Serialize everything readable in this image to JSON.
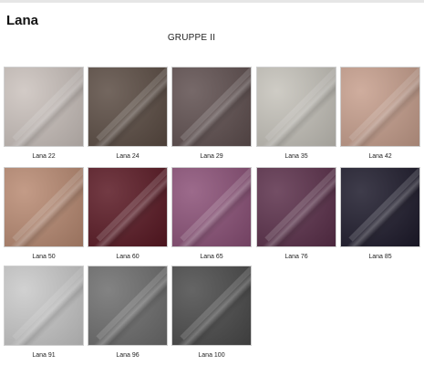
{
  "header": {
    "title": "Lana",
    "group": "GRUPPE II"
  },
  "swatches": [
    {
      "label": "Lana 22",
      "color": "#cbc2bd"
    },
    {
      "label": "Lana 24",
      "color": "#5b4c43"
    },
    {
      "label": "Lana 29",
      "color": "#5f4f4f"
    },
    {
      "label": "Lana 35",
      "color": "#c6c3bb"
    },
    {
      "label": "Lana 42",
      "color": "#c79f8d"
    },
    {
      "label": "Lana 50",
      "color": "#b98a72"
    },
    {
      "label": "Lana 60",
      "color": "#5a1823"
    },
    {
      "label": "Lana 65",
      "color": "#8b5077"
    },
    {
      "label": "Lana 76",
      "color": "#5b2f4a"
    },
    {
      "label": "Lana 85",
      "color": "#1d1a2b"
    },
    {
      "label": "Lana 91",
      "color": "#c9c9c9"
    },
    {
      "label": "Lana 96",
      "color": "#6d6d6d"
    },
    {
      "label": "Lana 100",
      "color": "#4a4a4a"
    }
  ]
}
